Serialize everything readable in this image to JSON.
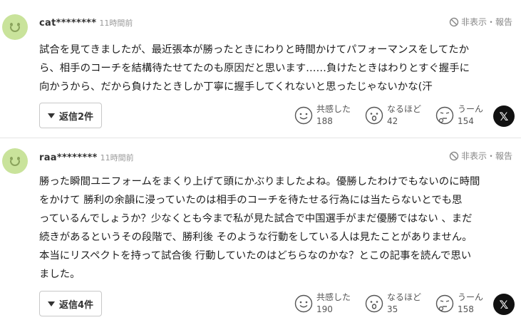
{
  "comments": [
    {
      "username": "cat********",
      "time": "11時間前",
      "report_label": "非表示・報告",
      "body": "試合を見てきましたが、最近張本が勝ったときにわりと時間かけてパフォーマンスをしてたか\nら、相手のコーチを結構待たせてたのも原因だと思います……負けたときはわりとすぐ握手に\n向かうから、だから負けたときしか丁寧に握手してくれないと思ったじゃないかな(汗",
      "reply_label": "返信2件",
      "reactions": [
        {
          "label": "共感した",
          "count": "188",
          "icon": "empathy-face-icon"
        },
        {
          "label": "なるほど",
          "count": "42",
          "icon": "surprised-face-icon"
        },
        {
          "label": "うーん",
          "count": "154",
          "icon": "thinking-face-icon"
        }
      ],
      "share_label": "𝕏"
    },
    {
      "username": "raa********",
      "time": "11時間前",
      "report_label": "非表示・報告",
      "body": "勝った瞬間ユニフォームをまくり上げて頭にかぶりましたよね。優勝したわけでもないのに時間\nをかけて 勝利の余韻に浸っていたのは相手のコーチを待たせる行為には当たらないとでも思\nっているんでしょうか？少なくとも今まで私が見た試合で中国選手がまだ優勝ではない 、まだ\n続きがあるというその段階で、勝利後 そのような行動をしている人は見たことがありません。\n本当にリスペクトを持って試合後 行動していたのはどちらなのかな？とこの記事を読んで思い\nました。",
      "reply_label": "返信4件",
      "reactions": [
        {
          "label": "共感した",
          "count": "190",
          "icon": "empathy-face-icon"
        },
        {
          "label": "なるほど",
          "count": "35",
          "icon": "surprised-face-icon"
        },
        {
          "label": "うーん",
          "count": "158",
          "icon": "thinking-face-icon"
        }
      ],
      "share_label": "𝕏"
    }
  ],
  "colors": {
    "avatar": "#c9e39b",
    "avatar_face": "#8aa35c",
    "text": "#1d1d1d",
    "muted": "#999999"
  }
}
